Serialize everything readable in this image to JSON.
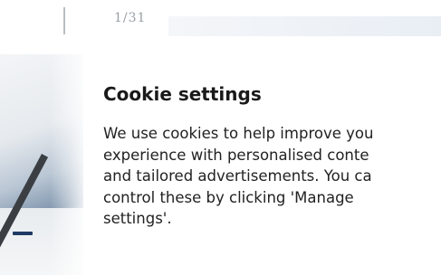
{
  "carousel": {
    "counter": "1/31"
  },
  "cookie_dialog": {
    "title": "Cookie settings",
    "body_lines": [
      "We use cookies to help improve you",
      "experience with personalised conte",
      "and tailored advertisements. You ca",
      "control these by clicking 'Manage",
      "settings'."
    ]
  },
  "colors": {
    "text": "#222222",
    "muted": "#9aa0a6",
    "background": "#ffffff"
  }
}
